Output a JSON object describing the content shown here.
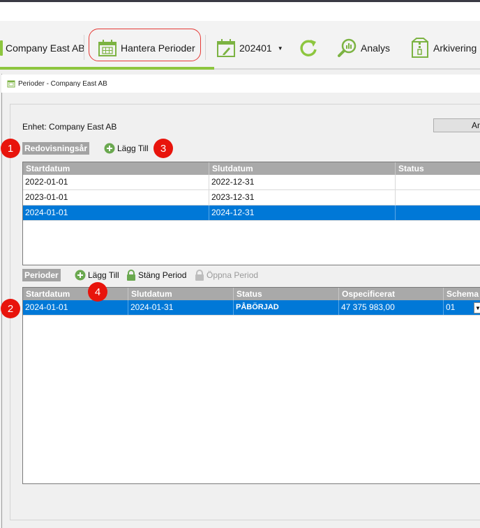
{
  "ribbon": {
    "company": "Company East AB",
    "manage_periods": "Hantera Perioder",
    "period": "202401",
    "analysis": "Analys",
    "archive": "Arkivering"
  },
  "window": {
    "title": "Perioder - Company East AB"
  },
  "form": {
    "unit_label": "Enhet: Company East AB",
    "right_button": "An"
  },
  "fiscal_years": {
    "section_label": "Redovisningsår",
    "add_label": "Lägg Till",
    "columns": [
      "Startdatum",
      "Slutdatum",
      "Status"
    ],
    "rows": [
      {
        "start": "2022-01-01",
        "end": "2022-12-31",
        "status": ""
      },
      {
        "start": "2023-01-01",
        "end": "2023-12-31",
        "status": ""
      },
      {
        "start": "2024-01-01",
        "end": "2024-12-31",
        "status": ""
      }
    ],
    "selected_index": 2
  },
  "periods": {
    "section_label": "Perioder",
    "add_label": "Lägg Till",
    "close_label": "Stäng Period",
    "open_label": "Öppna Period",
    "columns": [
      "Startdatum",
      "Slutdatum",
      "Status",
      "Ospecificerat",
      "Schema"
    ],
    "rows": [
      {
        "start": "2024-01-01",
        "end": "2024-01-31",
        "status": "PÅBÖRJAD",
        "unspecified": "47 375 983,00",
        "schema": "01"
      }
    ]
  },
  "badges": [
    "1",
    "2",
    "3",
    "4"
  ],
  "colors": {
    "accent_green": "#8dc63f",
    "selection_blue": "#0078d7",
    "badge_red": "#e8140c"
  }
}
